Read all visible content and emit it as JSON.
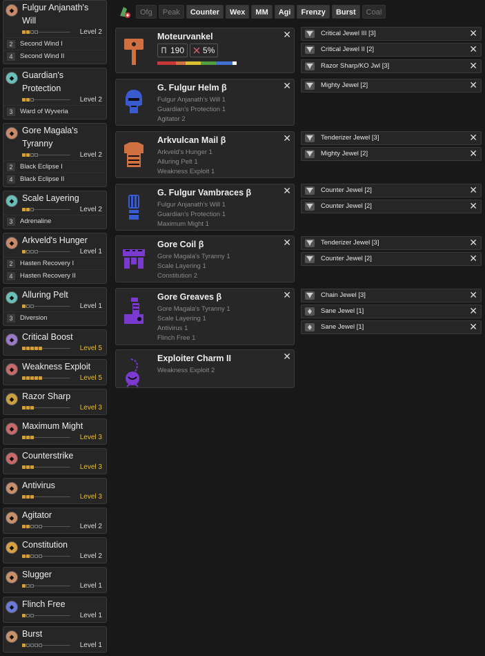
{
  "sidebar": {
    "skills": [
      {
        "name": "Fulgur Anjanath's Will",
        "name_lines": [
          "Fulgur Anjanath's",
          "Will"
        ],
        "icon": "set-bonus-icon",
        "icon_color": "#c88a6a",
        "level": "Level 2",
        "pips": [
          2,
          4
        ],
        "max": false,
        "bonuses": [
          {
            "pieces": "2",
            "label": "Second Wind I"
          },
          {
            "pieces": "4",
            "label": "Second Wind II"
          }
        ]
      },
      {
        "name": "Guardian's Protection",
        "name_lines": [
          "Guardian's",
          "Protection"
        ],
        "icon": "set-bonus-icon",
        "icon_color": "#6ac0b8",
        "level": "Level 2",
        "pips": [
          2,
          3
        ],
        "max": false,
        "bonuses": [
          {
            "pieces": "3",
            "label": "Ward of Wyveria"
          }
        ]
      },
      {
        "name": "Gore Magala's Tyranny",
        "name_lines": [
          "Gore Magala's",
          "Tyranny"
        ],
        "icon": "set-bonus-icon",
        "icon_color": "#c88a6a",
        "level": "Level 2",
        "pips": [
          2,
          4
        ],
        "max": false,
        "bonuses": [
          {
            "pieces": "2",
            "label": "Black Eclipse I"
          },
          {
            "pieces": "4",
            "label": "Black Eclipse II"
          }
        ]
      },
      {
        "name": "Scale Layering",
        "name_lines": [
          "Scale Layering"
        ],
        "icon": "set-bonus-icon",
        "icon_color": "#6ac0b8",
        "level": "Level 2",
        "pips": [
          2,
          3
        ],
        "max": false,
        "bonuses": [
          {
            "pieces": "3",
            "label": "Adrenaline"
          }
        ]
      },
      {
        "name": "Arkveld's Hunger",
        "name_lines": [
          "Arkveld's Hunger"
        ],
        "icon": "set-bonus-icon",
        "icon_color": "#c88a6a",
        "level": "Level 1",
        "pips": [
          1,
          4
        ],
        "max": false,
        "bonuses": [
          {
            "pieces": "2",
            "label": "Hasten Recovery I"
          },
          {
            "pieces": "4",
            "label": "Hasten Recovery II"
          }
        ]
      },
      {
        "name": "Alluring Pelt",
        "name_lines": [
          "Alluring Pelt"
        ],
        "icon": "set-bonus-icon",
        "icon_color": "#6ac0b8",
        "level": "Level 1",
        "pips": [
          1,
          3
        ],
        "max": false,
        "bonuses": [
          {
            "pieces": "3",
            "label": "Diversion"
          }
        ]
      },
      {
        "name": "Critical Boost",
        "name_lines": [
          "Critical Boost"
        ],
        "icon": "critical-boost-icon",
        "icon_color": "#9a7ac8",
        "level": "Level 5",
        "pips": [
          5,
          5
        ],
        "max": true,
        "bonuses": []
      },
      {
        "name": "Weakness Exploit",
        "name_lines": [
          "Weakness Exploit"
        ],
        "icon": "weakness-exploit-icon",
        "icon_color": "#c86a6a",
        "level": "Level 5",
        "pips": [
          5,
          5
        ],
        "max": true,
        "bonuses": []
      },
      {
        "name": "Razor Sharp",
        "name_lines": [
          "Razor Sharp"
        ],
        "icon": "razor-sharp-icon",
        "icon_color": "#c8a040",
        "level": "Level 3",
        "pips": [
          3,
          3
        ],
        "max": true,
        "bonuses": []
      },
      {
        "name": "Maximum Might",
        "name_lines": [
          "Maximum Might"
        ],
        "icon": "maximum-might-icon",
        "icon_color": "#c86a6a",
        "level": "Level 3",
        "pips": [
          3,
          3
        ],
        "max": true,
        "bonuses": []
      },
      {
        "name": "Counterstrike",
        "name_lines": [
          "Counterstrike"
        ],
        "icon": "counterstrike-icon",
        "icon_color": "#c86a6a",
        "level": "Level 3",
        "pips": [
          3,
          3
        ],
        "max": true,
        "bonuses": []
      },
      {
        "name": "Antivirus",
        "name_lines": [
          "Antivirus"
        ],
        "icon": "antivirus-icon",
        "icon_color": "#c8906a",
        "level": "Level 3",
        "pips": [
          3,
          3
        ],
        "max": true,
        "bonuses": []
      },
      {
        "name": "Agitator",
        "name_lines": [
          "Agitator"
        ],
        "icon": "agitator-icon",
        "icon_color": "#c8906a",
        "level": "Level 2",
        "pips": [
          2,
          5
        ],
        "max": false,
        "bonuses": []
      },
      {
        "name": "Constitution",
        "name_lines": [
          "Constitution"
        ],
        "icon": "constitution-icon",
        "icon_color": "#d8a040",
        "level": "Level 2",
        "pips": [
          2,
          5
        ],
        "max": false,
        "bonuses": []
      },
      {
        "name": "Slugger",
        "name_lines": [
          "Slugger"
        ],
        "icon": "slugger-icon",
        "icon_color": "#c8906a",
        "level": "Level 1",
        "pips": [
          1,
          3
        ],
        "max": false,
        "bonuses": []
      },
      {
        "name": "Flinch Free",
        "name_lines": [
          "Flinch Free"
        ],
        "icon": "flinch-free-icon",
        "icon_color": "#6a7ad8",
        "level": "Level 1",
        "pips": [
          1,
          3
        ],
        "max": false,
        "bonuses": []
      },
      {
        "name": "Burst",
        "name_lines": [
          "Burst"
        ],
        "icon": "burst-icon",
        "icon_color": "#c8906a",
        "level": "Level 1",
        "pips": [
          1,
          5
        ],
        "max": false,
        "bonuses": []
      }
    ]
  },
  "filters": [
    {
      "label": "Ofg",
      "active": false
    },
    {
      "label": "Peak",
      "active": false
    },
    {
      "label": "Counter",
      "active": true
    },
    {
      "label": "Wex",
      "active": true
    },
    {
      "label": "MM",
      "active": true
    },
    {
      "label": "Agi",
      "active": true
    },
    {
      "label": "Frenzy",
      "active": true
    },
    {
      "label": "Burst",
      "active": true
    },
    {
      "label": "Coal",
      "active": false
    }
  ],
  "equipment": [
    {
      "slot": "weapon",
      "name": "Moteurvankel",
      "icon": "hammer-icon",
      "color": "#d07040",
      "attack": "190",
      "affinity": "5%",
      "sharpness": [
        {
          "c": "#c83838",
          "w": 1
        },
        {
          "c": "#d07040",
          "w": 0.5
        },
        {
          "c": "#d8c030",
          "w": 0.8
        },
        {
          "c": "#50a040",
          "w": 0.8
        },
        {
          "c": "#4070d0",
          "w": 0.9
        },
        {
          "c": "#ffffff",
          "w": 0.2
        }
      ],
      "skills": []
    },
    {
      "slot": "head",
      "name": "G. Fulgur Helm β",
      "icon": "helm-icon",
      "color": "#3a5ad0",
      "skills": [
        "Fulgur Anjanath's Will 1",
        "Guardian's Protection 1",
        "Agitator 2"
      ]
    },
    {
      "slot": "chest",
      "name": "Arkvulcan Mail β",
      "icon": "chest-icon",
      "color": "#d07040",
      "skills": [
        "Arkveld's Hunger 1",
        "Alluring Pelt 1",
        "Weakness Exploit 1"
      ]
    },
    {
      "slot": "arms",
      "name": "G. Fulgur Vambraces β",
      "icon": "arms-icon",
      "color": "#3a5ad0",
      "skills": [
        "Fulgur Anjanath's Will 1",
        "Guardian's Protection 1",
        "Maximum Might 1"
      ]
    },
    {
      "slot": "waist",
      "name": "Gore Coil β",
      "icon": "waist-icon",
      "color": "#7a3ad0",
      "skills": [
        "Gore Magala's Tyranny 1",
        "Scale Layering 1",
        "Constitution 2"
      ]
    },
    {
      "slot": "legs",
      "name": "Gore Greaves β",
      "icon": "legs-icon",
      "color": "#7a3ad0",
      "skills": [
        "Gore Magala's Tyranny 1",
        "Scale Layering 1",
        "Antivirus 1",
        "Flinch Free 1"
      ]
    },
    {
      "slot": "charm",
      "name": "Exploiter Charm II",
      "icon": "charm-icon",
      "color": "#7a3ad0",
      "skills": [
        "Weakness Exploit 2"
      ]
    }
  ],
  "jewels": [
    {
      "name": "Critical Jewel III [3]",
      "group": "weapon",
      "size": 3
    },
    {
      "name": "Critical Jewel II [2]",
      "group": "weapon",
      "size": 3
    },
    {
      "name": "Razor Sharp/KO Jwl [3]",
      "group": "weapon",
      "size": 3
    },
    {
      "name": "Mighty Jewel [2]",
      "group": "head",
      "size": 3
    },
    {
      "name": "Tenderizer Jewel [3]",
      "group": "chest",
      "size": 3
    },
    {
      "name": "Mighty Jewel [2]",
      "group": "chest",
      "size": 3
    },
    {
      "name": "Counter Jewel [2]",
      "group": "arms",
      "size": 3
    },
    {
      "name": "Counter Jewel [2]",
      "group": "arms",
      "size": 3
    },
    {
      "name": "Tenderizer Jewel [3]",
      "group": "waist",
      "size": 3
    },
    {
      "name": "Counter Jewel [2]",
      "group": "waist",
      "size": 3
    },
    {
      "name": "Chain Jewel [3]",
      "group": "legs",
      "size": 3
    },
    {
      "name": "Sane Jewel [1]",
      "group": "legs",
      "size": 1
    },
    {
      "name": "Sane Jewel [1]",
      "group": "legs",
      "size": 1
    }
  ],
  "close_glyph": "✕"
}
